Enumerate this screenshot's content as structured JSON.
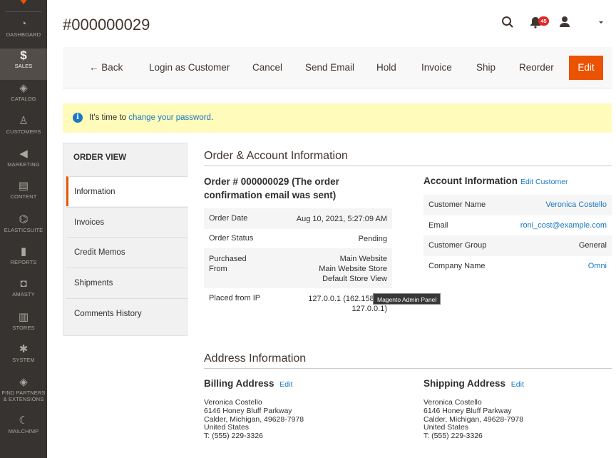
{
  "sidebar": {
    "items": [
      {
        "label": "DASHBOARD",
        "icon": "dashboard-icon",
        "glyph": "◔"
      },
      {
        "label": "SALES",
        "icon": "dollar-icon",
        "glyph": "$"
      },
      {
        "label": "CATALOG",
        "icon": "box-icon",
        "glyph": "◈"
      },
      {
        "label": "CUSTOMERS",
        "icon": "person-icon",
        "glyph": "♙"
      },
      {
        "label": "MARKETING",
        "icon": "megaphone-icon",
        "glyph": "◀"
      },
      {
        "label": "CONTENT",
        "icon": "layout-icon",
        "glyph": "▤"
      },
      {
        "label": "ELASTICSUITE",
        "icon": "elasticsuite-icon",
        "glyph": "⌬"
      },
      {
        "label": "REPORTS",
        "icon": "bar-chart-icon",
        "glyph": "▮"
      },
      {
        "label": "AMASTY",
        "icon": "amasty-icon",
        "glyph": "◘"
      },
      {
        "label": "STORES",
        "icon": "store-icon",
        "glyph": "▥"
      },
      {
        "label": "SYSTEM",
        "icon": "gear-icon",
        "glyph": "✱"
      },
      {
        "label": "FIND PARTNERS & EXTENSIONS",
        "icon": "extensions-icon",
        "glyph": "◈"
      },
      {
        "label": "MAILCHIMP",
        "icon": "mailchimp-icon",
        "glyph": "☾"
      }
    ]
  },
  "header": {
    "title": "#000000029",
    "notification_count": "45"
  },
  "toolbar": {
    "back": "← Back",
    "login_as_customer": "Login as Customer",
    "cancel": "Cancel",
    "send_email": "Send Email",
    "hold": "Hold",
    "invoice": "Invoice",
    "ship": "Ship",
    "reorder": "Reorder",
    "edit": "Edit"
  },
  "message": {
    "prefix": "It's time to ",
    "link": "change your password",
    "suffix": "."
  },
  "order_view": {
    "title": "ORDER VIEW",
    "tabs": [
      "Information",
      "Invoices",
      "Credit Memos",
      "Shipments",
      "Comments History"
    ]
  },
  "order_account": {
    "section_title": "Order & Account Information",
    "order_heading": "Order # 000000029 (The order confirmation email was sent)",
    "order_date_label": "Order Date",
    "order_date": "Aug 10, 2021, 5:27:09 AM",
    "order_status_label": "Order Status",
    "order_status": "Pending",
    "purchased_from_label_1": "Purchased",
    "purchased_from_label_2": "From",
    "purchased_from_1": "Main Website",
    "purchased_from_2": "Main Website Store",
    "purchased_from_3": "Default Store View",
    "placed_from_ip_label": "Placed from IP",
    "placed_from_ip_1": "127.0.0.1 (162.158.91.",
    "placed_from_ip_2": "127.0.0.1)",
    "tooltip": "Magento Admin Panel"
  },
  "account": {
    "heading": "Account Information",
    "edit_link": "Edit Customer",
    "rows": [
      {
        "label": "Customer Name",
        "value": "Veronica Costello"
      },
      {
        "label": "Email",
        "value": "roni_cost@example.com"
      },
      {
        "label": "Customer Group",
        "value": "General"
      },
      {
        "label": "Company Name",
        "value": "Omni"
      }
    ]
  },
  "address": {
    "section_title": "Address Information",
    "billing_heading": "Billing Address",
    "shipping_heading": "Shipping Address",
    "edit_link": "Edit",
    "billing_lines": [
      "Veronica Costello",
      "6146 Honey Bluff Parkway",
      "Calder, Michigan, 49628-7978",
      "United States",
      "T: (555) 229-3326"
    ],
    "shipping_lines": [
      "Veronica Costello",
      "6146 Honey Bluff Parkway",
      "Calder, Michigan, 49628-7978",
      "United States",
      "T: (555) 229-3326"
    ]
  },
  "colors": {
    "sidebar_bg": "#373330",
    "accent": "#eb5202",
    "link": "#1979c3",
    "message_bg": "#fffbbb"
  }
}
